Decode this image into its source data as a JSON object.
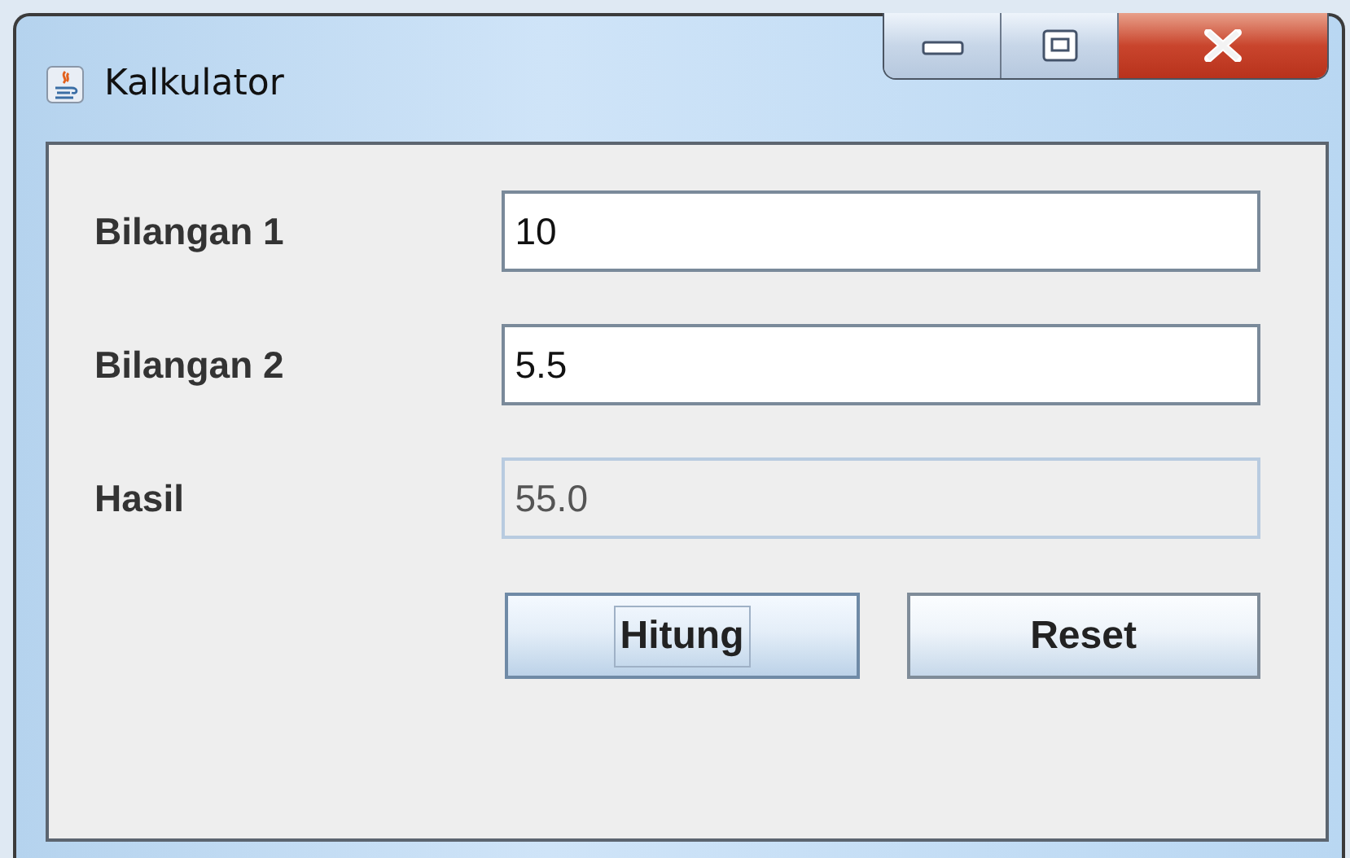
{
  "window": {
    "title": "Kalkulator"
  },
  "fields": [
    {
      "label": "Bilangan 1",
      "value": "10",
      "editable": true
    },
    {
      "label": "Bilangan 2",
      "value": "5.5",
      "editable": true
    },
    {
      "label": "Hasil",
      "value": "55.0",
      "editable": false
    }
  ],
  "buttons": [
    {
      "label": "Hitung",
      "focused": true
    },
    {
      "label": "Reset",
      "focused": false
    }
  ]
}
